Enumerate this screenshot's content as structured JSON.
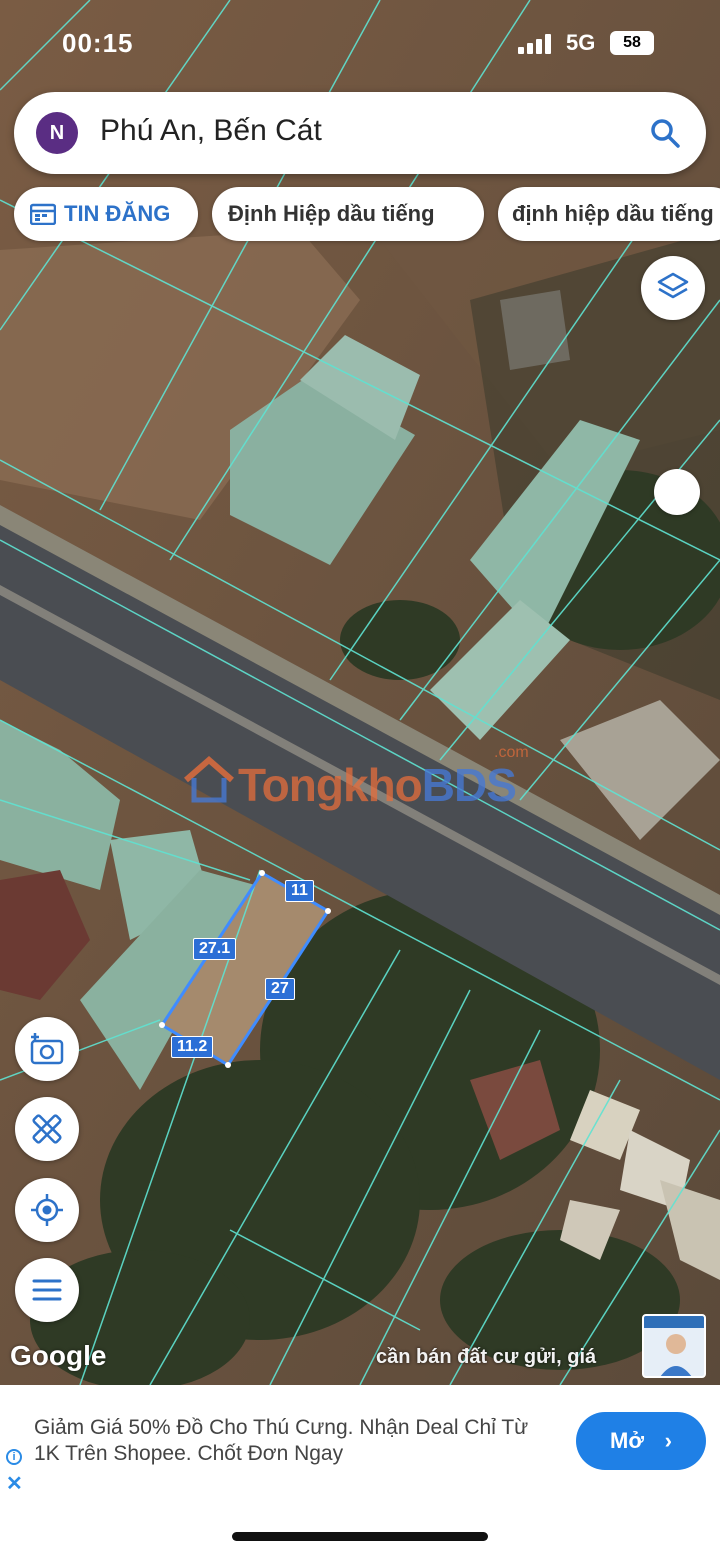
{
  "status_bar": {
    "time": "00:15",
    "network": "5G",
    "battery": "58"
  },
  "search": {
    "text": "Phú An, Bến Cát"
  },
  "chips": [
    {
      "label": "TIN ĐĂNG"
    },
    {
      "label": "Định Hiệp dầu tiếng"
    },
    {
      "label": "định hiệp dầu tiếng"
    }
  ],
  "map": {
    "watermark": {
      "brand_a": "Tongkho",
      "brand_b": "BDS",
      "suffix": ".com"
    },
    "dimensions": {
      "top": "11",
      "left": "27.1",
      "right": "27",
      "bottom": "11.2"
    },
    "attribution": "Google",
    "caption": "cần bán đất cư gửi, giá"
  },
  "icons": {
    "layers": "layers-icon",
    "camera": "add-photo-icon",
    "measure": "measure-tools-icon",
    "locate": "my-location-icon",
    "menu": "menu-icon"
  },
  "ad": {
    "text": "Giảm Giá 50% Đồ Cho Thú Cưng. Nhận Deal Chỉ Từ 1K Trên Shopee. Chốt Đơn Ngay",
    "cta": "Mở",
    "info": "i",
    "close": "✕"
  },
  "colors": {
    "accent": "#1f80e6",
    "chip_accent": "#2d72c9",
    "parcel_lines": "#5fe3d2",
    "plot_outline": "#3f8cff"
  }
}
